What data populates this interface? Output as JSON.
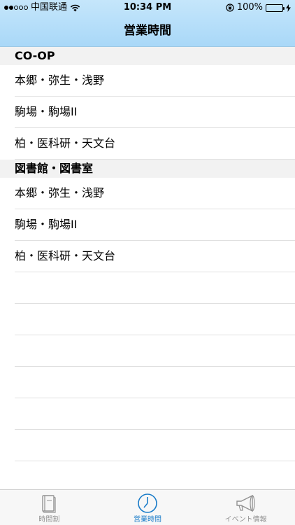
{
  "status": {
    "carrier": "中国联通",
    "time": "10:34 PM",
    "battery": "100%"
  },
  "nav": {
    "title": "営業時間"
  },
  "sections": [
    {
      "header": "CO-OP",
      "items": [
        "本郷・弥生・浅野",
        "駒場・駒場II",
        "柏・医科研・天文台"
      ]
    },
    {
      "header": "図書館・図書室",
      "items": [
        "本郷・弥生・浅野",
        "駒場・駒場II",
        "柏・医科研・天文台"
      ]
    }
  ],
  "tabs": [
    {
      "label": "時間割",
      "icon": "book-icon"
    },
    {
      "label": "営業時間",
      "icon": "clock-icon",
      "active": true
    },
    {
      "label": "イベント情報",
      "icon": "megaphone-icon"
    }
  ],
  "colors": {
    "accent": "#1a7cc9",
    "header_bg": "#c5e6fb"
  }
}
